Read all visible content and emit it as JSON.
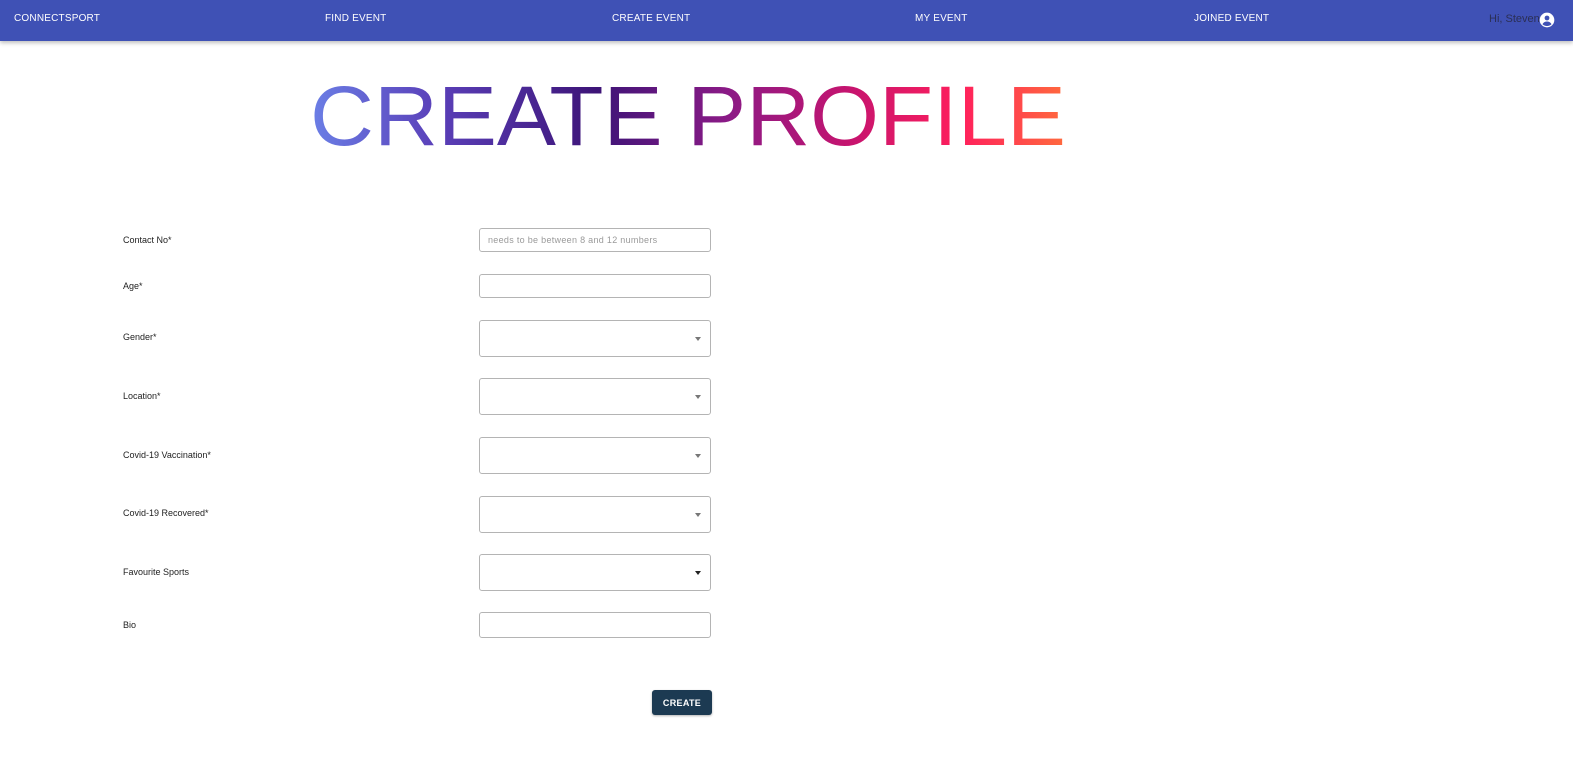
{
  "nav": {
    "brand": "CONNECTSPORT",
    "find_event": "FIND EVENT",
    "create_event": "CREATE EVENT",
    "my_event": "MY EVENT",
    "joined_event": "JOINED EVENT",
    "greeting": "Hi, Steven",
    "account_icon": "account-circle-icon"
  },
  "page": {
    "title": "CREATE PROFILE",
    "title_gradient": [
      "#6b7fe6",
      "#5a3fb8",
      "#3d1477",
      "#8a1a86",
      "#c8146e",
      "#ff1f5c",
      "#ff6a3d"
    ]
  },
  "form": {
    "contact_label": "Contact No*",
    "contact_placeholder": "needs to be between 8 and 12 numbers",
    "contact_value": "",
    "age_label": "Age*",
    "age_value": "",
    "gender_label": "Gender*",
    "gender_value": "",
    "location_label": "Location*",
    "location_value": "",
    "vaccination_label": "Covid-19 Vaccination*",
    "vaccination_value": "",
    "recovered_label": "Covid-19 Recovered*",
    "recovered_value": "",
    "sports_label": "Favourite Sports",
    "sports_value": "",
    "bio_label": "Bio",
    "bio_value": "",
    "create_button": "CREATE"
  },
  "colors": {
    "appbar": "#3f51b5",
    "button": "#1c3a52"
  }
}
